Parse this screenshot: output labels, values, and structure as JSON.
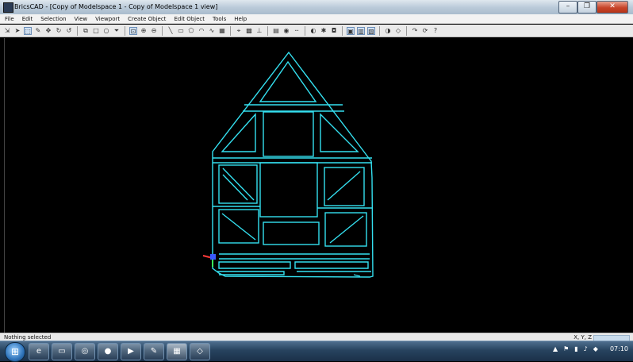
{
  "window": {
    "title": "BricsCAD - [Copy of Modelspace 1 - Copy of Modelspace 1 view]",
    "minimize_glyph": "–",
    "maximize_glyph": "❐",
    "close_glyph": "✕"
  },
  "menu": [
    "File",
    "Edit",
    "Selection",
    "View",
    "Viewport",
    "Create Object",
    "Edit Object",
    "Tools",
    "Help"
  ],
  "toolbar_icons": [
    "select-icon",
    "pointer-icon",
    "box-select-icon",
    "pencil-icon",
    "move-icon",
    "rotate-icon",
    "undo-arc-icon",
    "sep",
    "copy-icon",
    "square-icon",
    "circle-icon",
    "funnel-icon",
    "sep",
    "zoom-window-icon",
    "zoom-in-icon",
    "zoom-out-icon",
    "sep",
    "line-icon",
    "rectangle-icon",
    "polygon-icon",
    "arc-icon",
    "spline-icon",
    "hatch-icon",
    "sep",
    "snap-icon",
    "grid-icon",
    "ortho-icon",
    "sep",
    "layer-icon",
    "color-icon",
    "linetype-icon",
    "sep",
    "render-icon",
    "light-icon",
    "camera-icon",
    "sep",
    "view-top-icon",
    "view-front-icon",
    "view-side-icon",
    "sep",
    "shade-icon",
    "wire-icon",
    "sep",
    "redo-icon",
    "refresh-icon",
    "help-icon"
  ],
  "statusbar": {
    "message": "Nothing selected",
    "coords": "X, Y, Z"
  },
  "drawing": {
    "wire_color": "#34e0f0",
    "background": "#000000"
  },
  "taskbar": {
    "apps": [
      "ie-icon",
      "explorer-icon",
      "chrome-icon",
      "firefox-icon",
      "media-icon",
      "paint-icon",
      "cad-icon",
      "app-icon"
    ],
    "clock": "07:10"
  }
}
